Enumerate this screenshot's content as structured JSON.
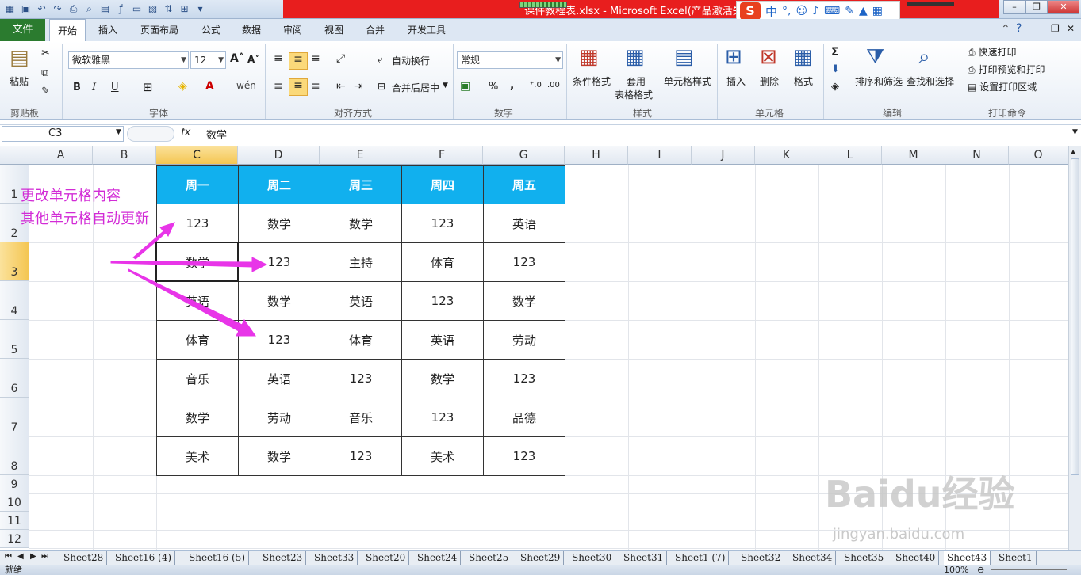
{
  "window": {
    "title": "课件教程表.xlsx - Microsoft Excel(产品激活失败)",
    "ime": {
      "logo": "S",
      "mode": "中",
      "punct": "°,"
    }
  },
  "ribbon_tabs": [
    "文件",
    "开始",
    "插入",
    "页面布局",
    "公式",
    "数据",
    "审阅",
    "视图",
    "合并",
    "开发工具"
  ],
  "active_tab": "开始",
  "ribbon": {
    "clipboard": {
      "paste": "粘贴",
      "label": "剪贴板"
    },
    "font": {
      "name": "微软雅黑",
      "size": "12",
      "label": "字体",
      "bold": "B",
      "italic": "I",
      "underline": "U"
    },
    "alignment": {
      "wrap": "自动换行",
      "merge": "合并后居中",
      "label": "对齐方式"
    },
    "number": {
      "format": "常规",
      "label": "数字",
      "percent": "%",
      "comma": ","
    },
    "styles": {
      "conditional": "条件格式",
      "table_fmt_1": "套用",
      "table_fmt_2": "表格格式",
      "cell_styles": "单元格样式",
      "label": "样式"
    },
    "cells": {
      "insert": "插入",
      "delete": "删除",
      "format": "格式",
      "label": "单元格"
    },
    "editing": {
      "sort": "排序和筛选",
      "find": "查找和选择",
      "label": "编辑"
    },
    "print": {
      "quick": "快速打印",
      "preview": "打印预览和打印",
      "area": "设置打印区域",
      "label": "打印命令"
    }
  },
  "formula_bar": {
    "name_box": "C3",
    "fx": "fx",
    "content": "数学"
  },
  "columns": [
    "A",
    "B",
    "C",
    "D",
    "E",
    "F",
    "G",
    "H",
    "I",
    "J",
    "K",
    "L",
    "M",
    "N",
    "O"
  ],
  "selected_column": "C",
  "rows": [
    "1",
    "2",
    "3",
    "4",
    "5",
    "6",
    "7",
    "8",
    "9",
    "10",
    "11",
    "12"
  ],
  "selected_row": "3",
  "table": {
    "header": [
      "周一",
      "周二",
      "周三",
      "周四",
      "周五"
    ],
    "body": [
      [
        "123",
        "数学",
        "数学",
        "123",
        "英语"
      ],
      [
        "数学",
        "123",
        "主持",
        "体育",
        "123"
      ],
      [
        "英语",
        "数学",
        "英语",
        "123",
        "数学"
      ],
      [
        "体育",
        "123",
        "体育",
        "英语",
        "劳动"
      ],
      [
        "音乐",
        "英语",
        "123",
        "数学",
        "123"
      ],
      [
        "数学",
        "劳动",
        "音乐",
        "123",
        "品德"
      ],
      [
        "美术",
        "数学",
        "123",
        "美术",
        "123"
      ]
    ],
    "header_color": "#11b0ee"
  },
  "annotation": {
    "line1": "更改单元格内容",
    "line2": "其他单元格自动更新",
    "color": "#d22bd6"
  },
  "sheets": [
    "Sheet28",
    "Sheet16 (4)",
    "Sheet16 (5)",
    "Sheet23",
    "Sheet33",
    "Sheet20",
    "Sheet24",
    "Sheet25",
    "Sheet29",
    "Sheet30",
    "Sheet31",
    "Sheet1 (7)",
    "Sheet32",
    "Sheet34",
    "Sheet35",
    "Sheet40",
    "Sheet43",
    "Sheet1"
  ],
  "active_sheet": "Sheet43",
  "status": {
    "ready": "就绪",
    "zoom": "100%"
  },
  "watermark": {
    "brand": "Baidu经验",
    "url": "jingyan.baidu.com"
  }
}
